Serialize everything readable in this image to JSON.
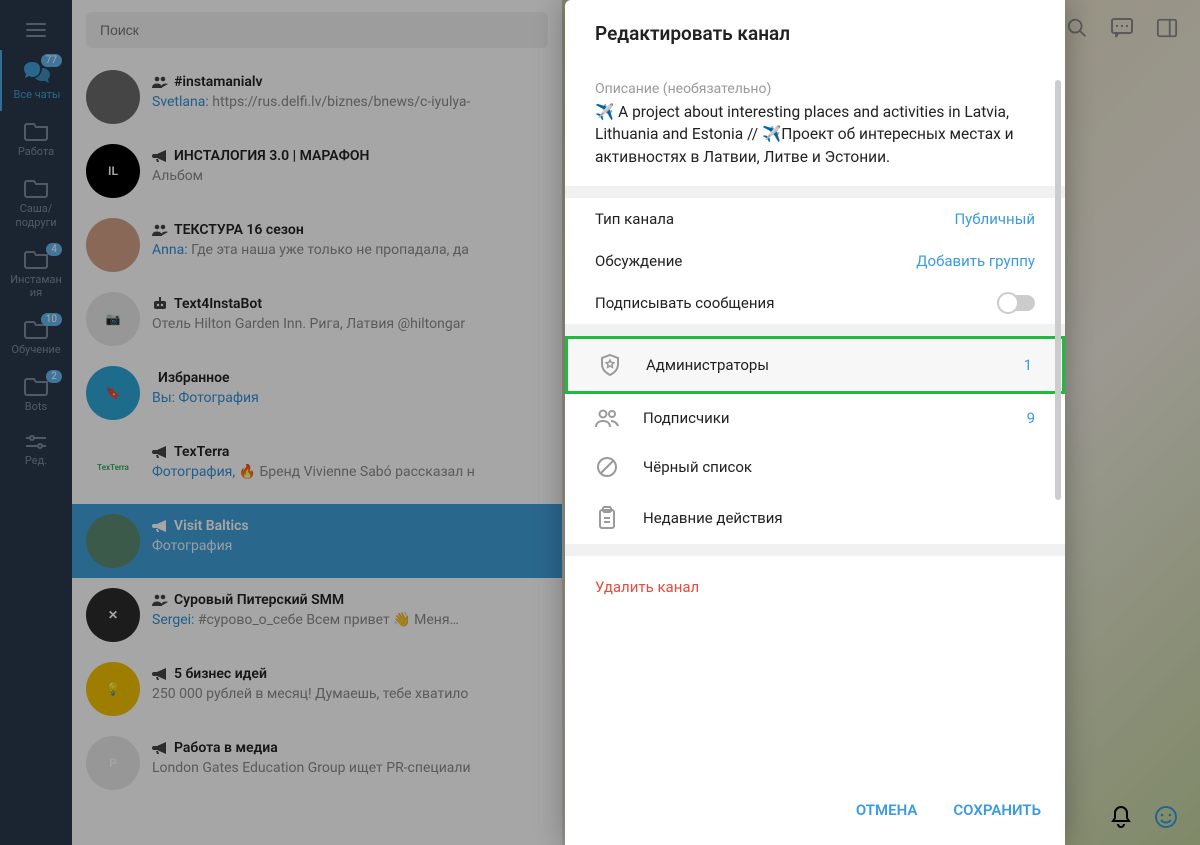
{
  "search": {
    "placeholder": "Поиск"
  },
  "nav": {
    "items": [
      {
        "label": "Все чаты",
        "badge": "77",
        "active": true
      },
      {
        "label": "Работа",
        "badge": ""
      },
      {
        "label": "Саша/ подруги",
        "badge": ""
      },
      {
        "label": "Инстаман ия",
        "badge": "4"
      },
      {
        "label": "Обучение",
        "badge": "10"
      },
      {
        "label": "Bots",
        "badge": "2"
      },
      {
        "label": "Ред.",
        "badge": ""
      }
    ]
  },
  "chats": [
    {
      "title": "#instamanialv",
      "sender": "Svetlana:",
      "preview": " https://rus.delfi.lv/biznes/bnews/c-iyulya-",
      "av_bg": "#6b6b6b",
      "av_txt": "",
      "type": "group"
    },
    {
      "title": "ИНСТАЛОГИЯ 3.0 | МАРАФОН",
      "sender": "",
      "preview": "Альбом",
      "av_bg": "#000",
      "av_txt": "IL",
      "type": "channel",
      "sender_link": true
    },
    {
      "title": "ТЕКСТУРА 16 сезон",
      "sender": "Anna:",
      "preview": " Где эта наша уже только не пропадала, да",
      "av_bg": "#d4a088",
      "av_txt": "",
      "type": "group"
    },
    {
      "title": "Text4InstaBot",
      "sender": "",
      "preview": "Отель Hilton Garden Inn. Рига, Латвия @hiltongar",
      "av_bg": "#e8e8e8",
      "av_txt": "📷",
      "type": "bot"
    },
    {
      "title": "Избранное",
      "sender": "Вы:",
      "preview": " Фотография",
      "av_bg": "#2ea6d6",
      "av_txt": "🔖",
      "type": "saved",
      "sender_link": true,
      "preview_link": true
    },
    {
      "title": "TexTerra",
      "sender": "",
      "preview": "Фотография, 🔥 Бренд Vivienne Sabó рассказал н",
      "av_bg": "#fff",
      "av_txt": "TexTerra",
      "type": "channel",
      "preview_link_part": "Фотография,"
    },
    {
      "title": "Visit Baltics",
      "sender": "",
      "preview": "Фотография",
      "av_bg": "#5b8a72",
      "av_txt": "",
      "type": "channel",
      "active": true
    },
    {
      "title": "Суровый Питерский SMM",
      "sender": "Sergei:",
      "preview": " #сурово_о_себе  Всем привет 👋  Меня…",
      "av_bg": "#2c2c2c",
      "av_txt": "✕",
      "type": "group"
    },
    {
      "title": "5 бизнес идей",
      "sender": "",
      "preview": "250 000 рублей в месяц!  Думаешь, тебе хватило",
      "av_bg": "#f2c200",
      "av_txt": "💡",
      "type": "channel"
    },
    {
      "title": "Работа в медиа",
      "sender": "",
      "preview": "London Gates Education Group ищет PR-специали",
      "av_bg": "#e8e8e8",
      "av_txt": "Р",
      "type": "channel"
    }
  ],
  "modal": {
    "title": "Редактировать канал",
    "desc_label": "Описание (необязательно)",
    "description": "✈️ A project about interesting places and activities in Latvia, Lithuania and Estonia // ✈️Проект об интересных местах и активностях в Латвии, Литве и Эстонии.",
    "channel_type_label": "Тип канала",
    "channel_type_value": "Публичный",
    "discussion_label": "Обсуждение",
    "discussion_value": "Добавить группу",
    "sign_label": "Подписывать сообщения",
    "admins_label": "Администраторы",
    "admins_count": "1",
    "subscribers_label": "Подписчики",
    "subscribers_count": "9",
    "blacklist_label": "Чёрный список",
    "recent_label": "Недавние действия",
    "delete_label": "Удалить канал",
    "cancel": "ОТМЕНА",
    "save": "СОХРАНИТЬ"
  }
}
